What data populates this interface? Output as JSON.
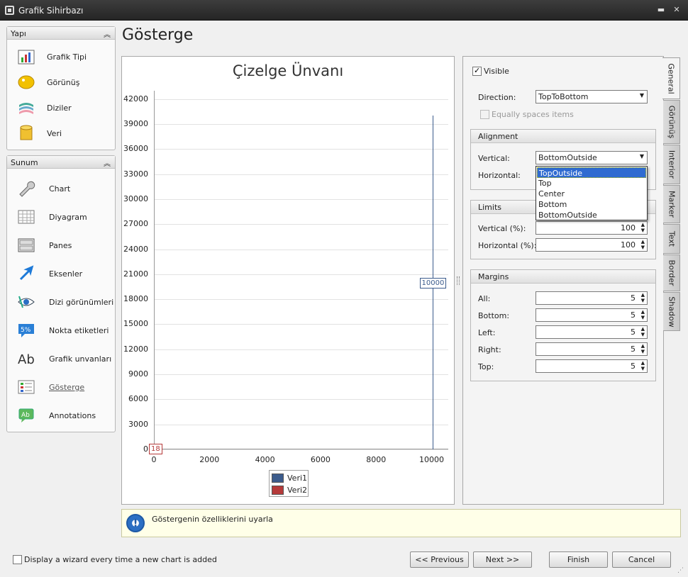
{
  "window": {
    "title": "Grafik Sihirbazı"
  },
  "sections": {
    "yapi": {
      "header": "Yapı",
      "items": [
        {
          "label": "Grafik Tipi",
          "icon": "bar-chart-icon"
        },
        {
          "label": "Görünüş",
          "icon": "palette-icon"
        },
        {
          "label": "Diziler",
          "icon": "series-icon"
        },
        {
          "label": "Veri",
          "icon": "database-icon"
        }
      ]
    },
    "sunum": {
      "header": "Sunum",
      "items": [
        {
          "label": "Chart",
          "icon": "wrench-icon"
        },
        {
          "label": "Diyagram",
          "icon": "grid-icon"
        },
        {
          "label": "Panes",
          "icon": "panes-icon"
        },
        {
          "label": "Eksenler",
          "icon": "axis-arrow-icon"
        },
        {
          "label": "Dizi görünümleri",
          "icon": "eye-icon"
        },
        {
          "label": "Nokta etiketleri",
          "icon": "percent-label-icon"
        },
        {
          "label": "Grafik unvanları",
          "icon": "title-ab-icon"
        },
        {
          "label": "Gösterge",
          "icon": "legend-icon"
        },
        {
          "label": "Annotations",
          "icon": "annotation-icon"
        }
      ]
    }
  },
  "page": {
    "title": "Gösterge"
  },
  "chart_data": {
    "type": "bar",
    "title": "Çizelge Ünvanı",
    "y_ticks": [
      "42000",
      "39000",
      "36000",
      "33000",
      "30000",
      "27000",
      "24000",
      "21000",
      "18000",
      "15000",
      "12000",
      "9000",
      "6000",
      "3000",
      "0"
    ],
    "x_ticks": [
      "0",
      "2000",
      "4000",
      "6000",
      "8000",
      "10000"
    ],
    "xlim": [
      0,
      10600
    ],
    "ylim": [
      0,
      43000
    ],
    "series": [
      {
        "name": "Veri1",
        "color": "#3b5b8c",
        "x": [
          10000
        ],
        "values": [
          40000
        ],
        "label": "10000"
      },
      {
        "name": "Veri2",
        "color": "#b53a3a",
        "x": [
          0
        ],
        "values": [
          18
        ],
        "label": "18"
      }
    ],
    "legend": "bottom-center",
    "grid": true
  },
  "hint": {
    "text": "Göstergenin özelliklerini uyarla"
  },
  "properties": {
    "visible_label": "Visible",
    "direction_label": "Direction:",
    "direction_value": "TopToBottom",
    "equally_label": "Equally spaces items",
    "alignment": {
      "header": "Alignment",
      "vertical_label": "Vertical:",
      "vertical_value": "BottomOutside",
      "horizontal_label": "Horizontal:"
    },
    "dropdown_options": [
      "TopOutside",
      "Top",
      "Center",
      "Bottom",
      "BottomOutside"
    ],
    "limits": {
      "header": "Limits",
      "vertical_label": "Vertical (%):",
      "vertical_value": "100",
      "horizontal_label": "Horizontal (%):",
      "horizontal_value": "100"
    },
    "margins": {
      "header": "Margins",
      "all_label": "All:",
      "all": "5",
      "bottom_label": "Bottom:",
      "bottom": "5",
      "left_label": "Left:",
      "left": "5",
      "right_label": "Right:",
      "right": "5",
      "top_label": "Top:",
      "top": "5"
    }
  },
  "tabs": [
    "General",
    "Görünüş",
    "Interior",
    "Marker",
    "Text",
    "Border",
    "Shadow"
  ],
  "footer": {
    "checkbox_label": "Display a wizard every time a new chart is added",
    "previous": "<< Previous",
    "next": "Next >>",
    "finish": "Finish",
    "cancel": "Cancel"
  }
}
